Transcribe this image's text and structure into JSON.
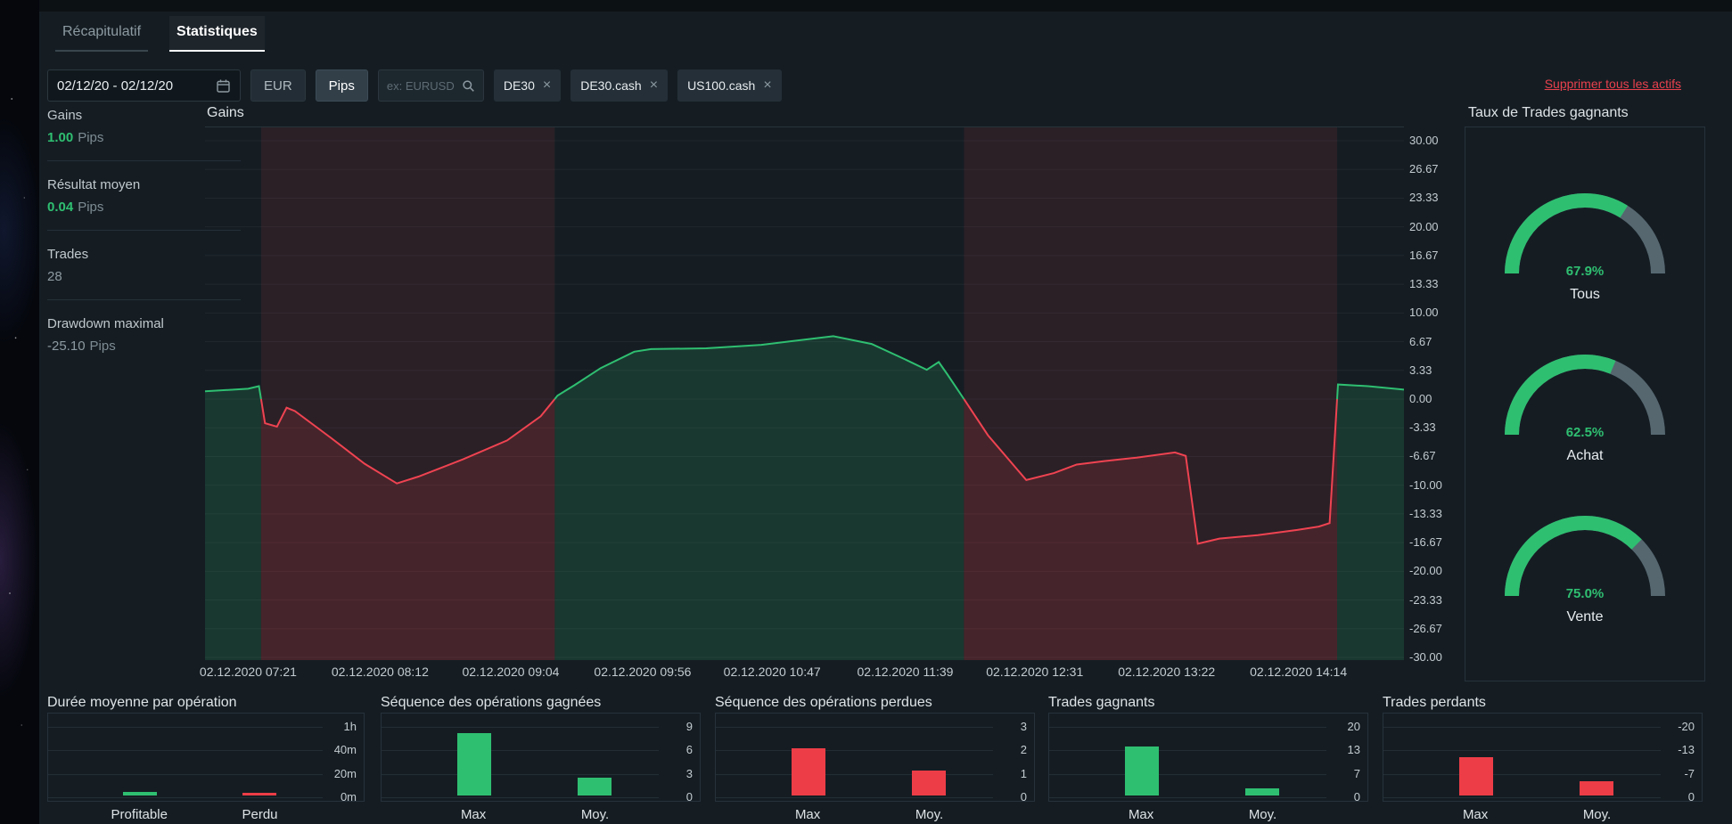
{
  "icons": {
    "close": "×"
  },
  "tabs": [
    {
      "label": "Récapitulatif",
      "active": false
    },
    {
      "label": "Statistiques",
      "active": true
    }
  ],
  "filters": {
    "date_range": "02/12/20 - 02/12/20",
    "currency": "EUR",
    "unit": "Pips",
    "search_placeholder": "ex: EURUSD",
    "chips": [
      {
        "label": "DE30"
      },
      {
        "label": "DE30.cash"
      },
      {
        "label": "US100.cash"
      }
    ],
    "remove_all": "Supprimer tous les actifs"
  },
  "summary": [
    {
      "label": "Gains",
      "value": "1.00",
      "unit": "Pips"
    },
    {
      "label": "Résultat moyen",
      "value": "0.04",
      "unit": "Pips"
    },
    {
      "label": "Trades",
      "value": "28",
      "unit": ""
    },
    {
      "label": "Drawdown maximal",
      "value": "-25.10",
      "unit": "Pips"
    }
  ],
  "gauges": {
    "title": "Taux de Trades gagnants",
    "items": [
      {
        "pct": 67.9,
        "pct_label": "67.9%",
        "label": "Tous"
      },
      {
        "pct": 62.5,
        "pct_label": "62.5%",
        "label": "Achat"
      },
      {
        "pct": 75.0,
        "pct_label": "75.0%",
        "label": "Vente"
      }
    ]
  },
  "chart_data": [
    {
      "id": "gains",
      "type": "area",
      "title": "Gains",
      "ylabel": "Pips",
      "ylim": [
        -30,
        30
      ],
      "grid": true,
      "yticks": [
        "30.00",
        "26.67",
        "23.33",
        "20.00",
        "16.67",
        "13.33",
        "10.00",
        "6.67",
        "3.33",
        "0.00",
        "-3.33",
        "-6.67",
        "-10.00",
        "-13.33",
        "-16.67",
        "-20.00",
        "-23.33",
        "-26.67",
        "-30.00"
      ],
      "xticks": [
        {
          "label": "02.12.2020 07:21",
          "x": 0.036
        },
        {
          "label": "02.12.2020 08:12",
          "x": 0.146
        },
        {
          "label": "02.12.2020 09:04",
          "x": 0.255
        },
        {
          "label": "02.12.2020 09:56",
          "x": 0.365
        },
        {
          "label": "02.12.2020 10:47",
          "x": 0.473
        },
        {
          "label": "02.12.2020 11:39",
          "x": 0.584
        },
        {
          "label": "02.12.2020 12:31",
          "x": 0.692
        },
        {
          "label": "02.12.2020 13:22",
          "x": 0.802
        },
        {
          "label": "02.12.2020 14:14",
          "x": 0.912
        }
      ],
      "points": [
        [
          0.0,
          0.9
        ],
        [
          0.036,
          1.2
        ],
        [
          0.045,
          1.5
        ],
        [
          0.05,
          -2.8
        ],
        [
          0.06,
          -3.2
        ],
        [
          0.068,
          -1.0
        ],
        [
          0.075,
          -1.4
        ],
        [
          0.105,
          -4.5
        ],
        [
          0.133,
          -7.5
        ],
        [
          0.16,
          -9.8
        ],
        [
          0.178,
          -9.0
        ],
        [
          0.215,
          -7.0
        ],
        [
          0.252,
          -4.8
        ],
        [
          0.28,
          -2.0
        ],
        [
          0.294,
          0.4
        ],
        [
          0.308,
          1.6
        ],
        [
          0.33,
          3.6
        ],
        [
          0.358,
          5.5
        ],
        [
          0.372,
          5.8
        ],
        [
          0.418,
          5.9
        ],
        [
          0.464,
          6.3
        ],
        [
          0.524,
          7.3
        ],
        [
          0.556,
          6.4
        ],
        [
          0.584,
          4.6
        ],
        [
          0.602,
          3.4
        ],
        [
          0.612,
          4.3
        ],
        [
          0.619,
          2.9
        ],
        [
          0.634,
          -0.2
        ],
        [
          0.653,
          -4.2
        ],
        [
          0.685,
          -9.4
        ],
        [
          0.708,
          -8.6
        ],
        [
          0.727,
          -7.6
        ],
        [
          0.75,
          -7.2
        ],
        [
          0.777,
          -6.8
        ],
        [
          0.809,
          -6.2
        ],
        [
          0.818,
          -6.6
        ],
        [
          0.828,
          -16.8
        ],
        [
          0.846,
          -16.2
        ],
        [
          0.878,
          -15.8
        ],
        [
          0.911,
          -15.2
        ],
        [
          0.929,
          -14.8
        ],
        [
          0.938,
          -14.4
        ],
        [
          0.945,
          1.7
        ],
        [
          0.97,
          1.5
        ],
        [
          1.0,
          1.1
        ]
      ],
      "pos_color": "#2fbf71",
      "neg_color": "#ef4351"
    },
    {
      "id": "winrate",
      "type": "gauge",
      "title": "Taux de Trades gagnants",
      "values": [
        {
          "label": "Tous",
          "pct": 67.9
        },
        {
          "label": "Achat",
          "pct": 62.5
        },
        {
          "label": "Vente",
          "pct": 75.0
        }
      ]
    },
    {
      "id": "duration",
      "type": "bar",
      "title": "Durée moyenne par opération",
      "yticks": [
        "1h",
        "40m",
        "20m",
        "0m"
      ],
      "ymax": 60,
      "categories": [
        "Profitable",
        "Perdu"
      ],
      "values": [
        3,
        2.5
      ],
      "colors": [
        "green",
        "red"
      ]
    },
    {
      "id": "win-streak",
      "type": "bar",
      "title": "Séquence des opérations gagnées",
      "yticks": [
        "9",
        "6",
        "3",
        "0"
      ],
      "ymax": 9,
      "categories": [
        "Max",
        "Moy."
      ],
      "values": [
        8,
        2.3
      ],
      "colors": [
        "green",
        "green"
      ]
    },
    {
      "id": "loss-streak",
      "type": "bar",
      "title": "Séquence des opérations perdues",
      "yticks": [
        "3",
        "2",
        "1",
        "0"
      ],
      "ymax": 3,
      "categories": [
        "Max",
        "Moy."
      ],
      "values": [
        2,
        1.05
      ],
      "colors": [
        "red",
        "red"
      ]
    },
    {
      "id": "winning-trades",
      "type": "bar",
      "title": "Trades gagnants",
      "yticks": [
        "20",
        "13",
        "7",
        "0"
      ],
      "ymax": 20,
      "categories": [
        "Max",
        "Moy."
      ],
      "values": [
        14,
        2
      ],
      "colors": [
        "green",
        "green"
      ]
    },
    {
      "id": "losing-trades",
      "type": "bar",
      "title": "Trades perdants",
      "yticks": [
        "-20",
        "-13",
        "-7",
        "0"
      ],
      "ymax": 20,
      "categories": [
        "Max",
        "Moy."
      ],
      "values": [
        11,
        4
      ],
      "colors": [
        "red",
        "red"
      ]
    }
  ]
}
